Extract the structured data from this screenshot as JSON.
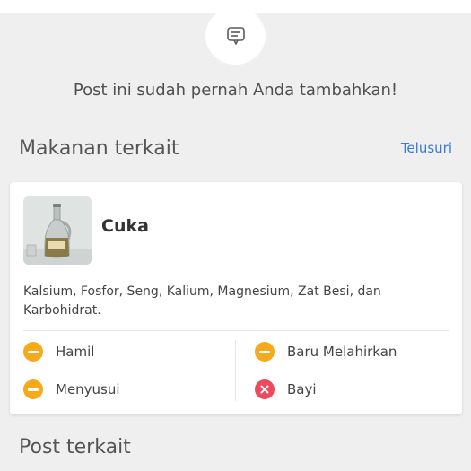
{
  "notice_text": "Post ini sudah pernah Anda tambahkan!",
  "related_food": {
    "title": "Makanan terkait",
    "browse_label": "Telusuri"
  },
  "food_card": {
    "name": "Cuka",
    "image_icon": "vinegar-bottle-image",
    "nutrients": "Kalsium, Fosfor, Seng, Kalium, Magnesium, Zat Besi, dan Karbohidrat.",
    "statuses": [
      {
        "label": "Hamil",
        "level": "caution"
      },
      {
        "label": "Baru Melahirkan",
        "level": "caution"
      },
      {
        "label": "Menyusui",
        "level": "caution"
      },
      {
        "label": "Bayi",
        "level": "not-allowed"
      }
    ]
  },
  "related_posts": {
    "title": "Post terkait"
  },
  "colors": {
    "caution": "#f5a91b",
    "not_allowed": "#ee4a5d",
    "link": "#3a7bd5",
    "background": "#efefef"
  },
  "icons": {
    "header": "comment-icon"
  }
}
